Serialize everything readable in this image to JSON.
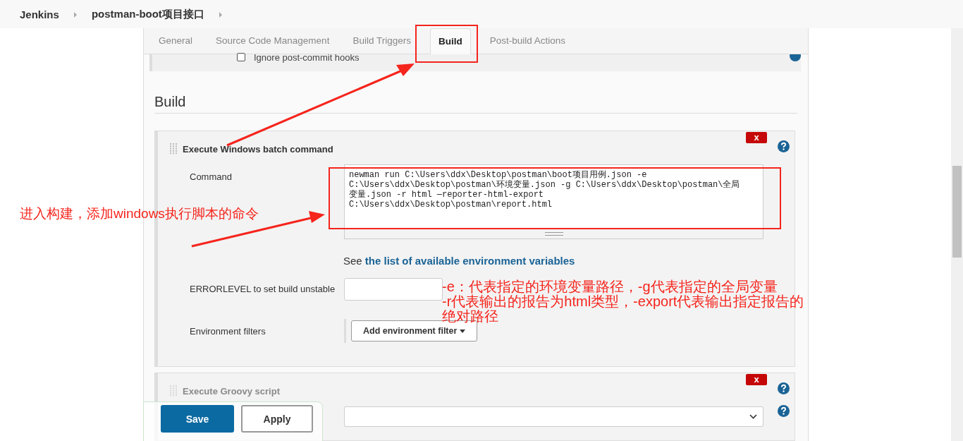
{
  "breadcrumbs": [
    {
      "label": "Jenkins"
    },
    {
      "label": "postman-boot项目接口"
    }
  ],
  "tabs": [
    {
      "label": "General",
      "selected": false
    },
    {
      "label": "Source Code Management",
      "selected": false
    },
    {
      "label": "Build Triggers",
      "selected": false
    },
    {
      "label": "Build",
      "selected": true
    },
    {
      "label": "Post-build Actions",
      "selected": false
    }
  ],
  "top_option": {
    "label": "Ignore post-commit hooks",
    "checked": false
  },
  "section_title": "Build",
  "steps": [
    {
      "kind": "batch",
      "title": "Execute Windows batch command",
      "delete_label": "x",
      "command_label": "Command",
      "command_value": "newman run C:\\Users\\ddx\\Desktop\\postman\\boot项目用例.json -e C:\\Users\\ddx\\Desktop\\postman\\环境变量.json -g C:\\Users\\ddx\\Desktop\\postman\\全局变量.json -r html —reporter-html-export C:\\Users\\ddx\\Desktop\\postman\\report.html",
      "see_prefix": "See",
      "see_link": "the list of available environment variables",
      "errorlevel_label": "ERRORLEVEL to set build unstable",
      "env_filters_label": "Environment filters",
      "add_filter_button": "Add environment filter"
    },
    {
      "kind": "groovy",
      "title": "Execute Groovy script",
      "delete_label": "x"
    }
  ],
  "buttons": [
    {
      "label": "Save",
      "kind": "primary"
    },
    {
      "label": "Apply",
      "kind": "secondary"
    }
  ],
  "annotations": {
    "left_note": "进入构建，添加windows执行脚本的命令",
    "notes": [
      "-e：代表指定的环境变量路径，-g代表指定的全局变量",
      "-r代表输出的报告为html类型，-export代表输出指定报告的绝对路径"
    ]
  }
}
